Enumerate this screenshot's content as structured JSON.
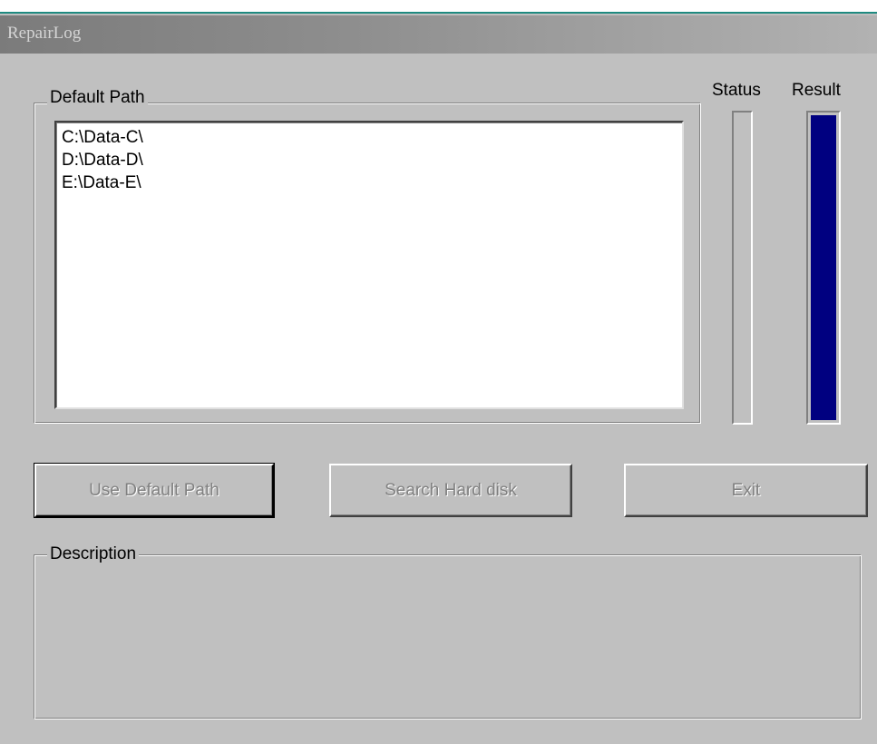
{
  "window": {
    "title": "RepairLog"
  },
  "default_path_group": {
    "label": "Default Path",
    "items": [
      "C:\\Data-C\\",
      "D:\\Data-D\\",
      "E:\\Data-E\\"
    ]
  },
  "status": {
    "label": "Status",
    "progress": 0
  },
  "result": {
    "label": "Result",
    "progress": 1.0,
    "fill_color": "#000080"
  },
  "buttons": {
    "use_default_path": "Use Default Path",
    "search_hard_disk": "Search Hard disk",
    "exit": "Exit"
  },
  "description_group": {
    "label": "Description"
  }
}
